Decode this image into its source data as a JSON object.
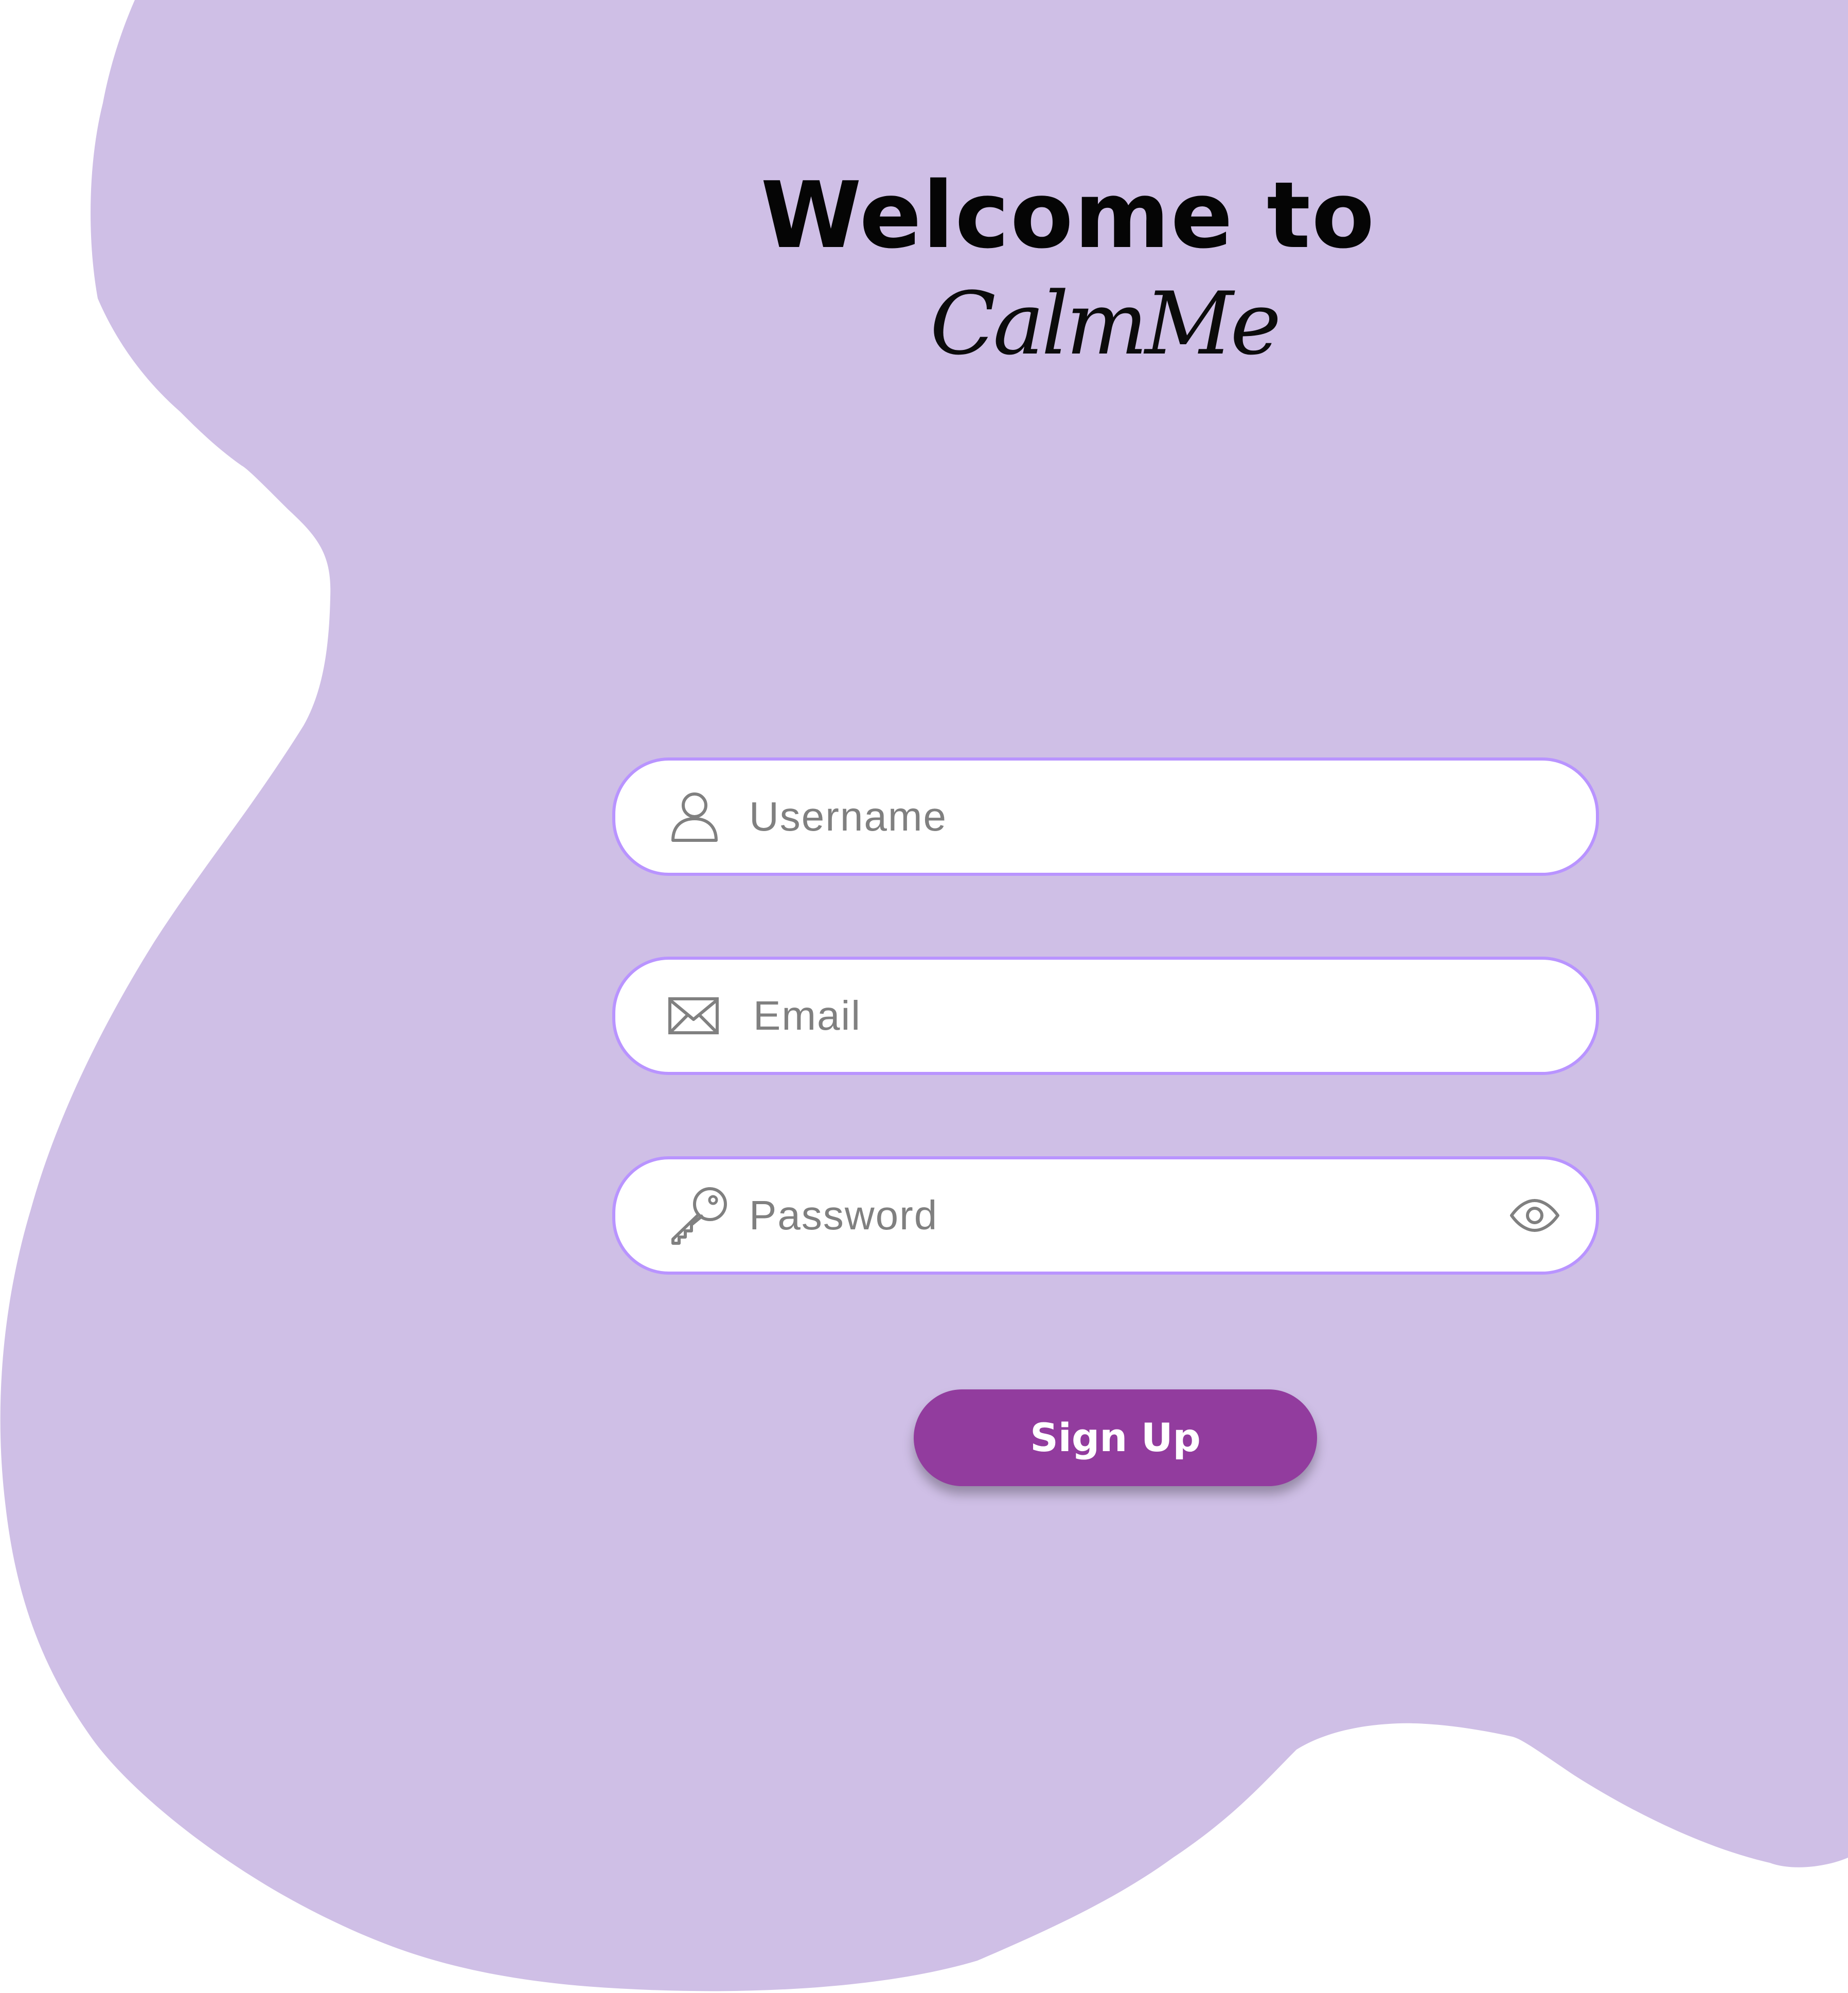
{
  "header": {
    "welcome_text": "Welcome to",
    "brand_name": "CalmMe"
  },
  "form": {
    "username": {
      "placeholder": "Username",
      "value": "",
      "icon": "user-icon"
    },
    "email": {
      "placeholder": "Email",
      "value": "",
      "icon": "envelope-icon"
    },
    "password": {
      "placeholder": "Password",
      "value": "",
      "icon": "key-icon",
      "toggle_icon": "eye-icon"
    },
    "submit_label": "Sign Up"
  },
  "colors": {
    "background": "#ffffff",
    "blob": "#cfbfe6",
    "field_border": "#b994ff",
    "field_fill": "#ffffff",
    "placeholder_text": "#808080",
    "button": "#923c9e",
    "button_text": "#ffffff",
    "title_text": "#050505"
  }
}
